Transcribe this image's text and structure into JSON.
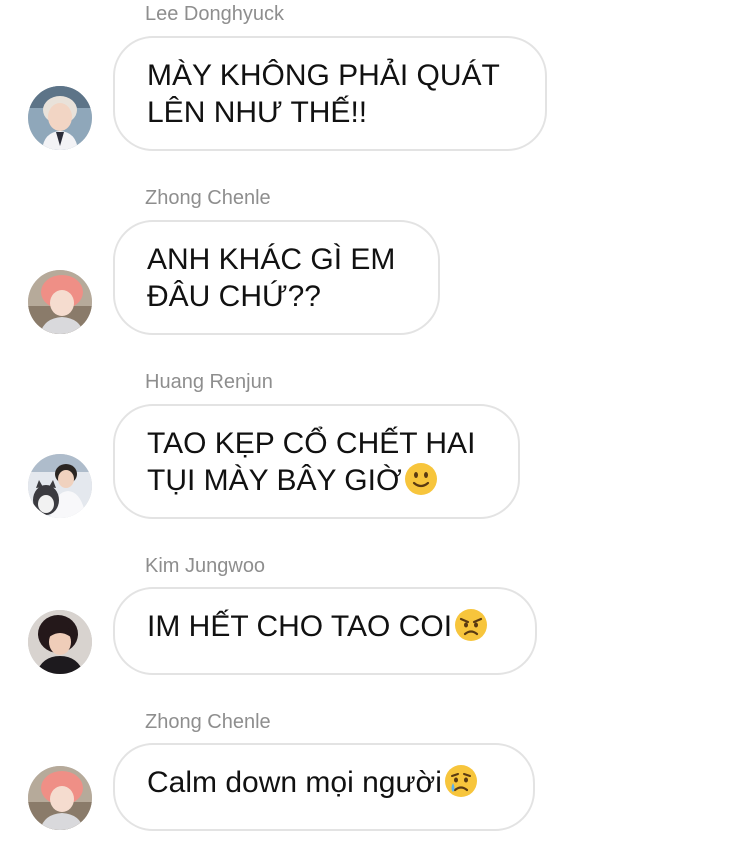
{
  "messages": [
    {
      "sender": "Lee Donghyuck",
      "lines": [
        "MÀY KHÔNG PHẢI QUÁT",
        "LÊN NHƯ THẾ!!"
      ],
      "avatar_icon": "avatar-photo-silver-hair"
    },
    {
      "sender": "Zhong Chenle",
      "lines": [
        "ANH KHÁC GÌ EM",
        "ĐÂU CHỨ??"
      ],
      "avatar_icon": "avatar-photo-pink-hair"
    },
    {
      "sender": "Huang Renjun",
      "lines": [
        "TAO KẸP CỔ CHẾT HAI",
        "TỤI MÀY BÂY GIỜ"
      ],
      "emoji": "slightly-smiling-face-icon",
      "avatar_icon": "avatar-photo-with-dog"
    },
    {
      "sender": "Kim Jungwoo",
      "lines": [
        "IM HẾT CHO TAO COI"
      ],
      "emoji": "angry-face-icon",
      "avatar_icon": "avatar-photo-dark-hair"
    },
    {
      "sender": "Zhong Chenle",
      "lines": [
        "Calm down mọi người"
      ],
      "emoji": "crying-face-icon",
      "avatar_icon": "avatar-photo-pink-hair"
    }
  ],
  "colors": {
    "sender_name": "#8e8e8e",
    "bubble_border": "#e3e3e3",
    "message_text": "#111111",
    "emoji_yellow": "#f7c53c"
  }
}
